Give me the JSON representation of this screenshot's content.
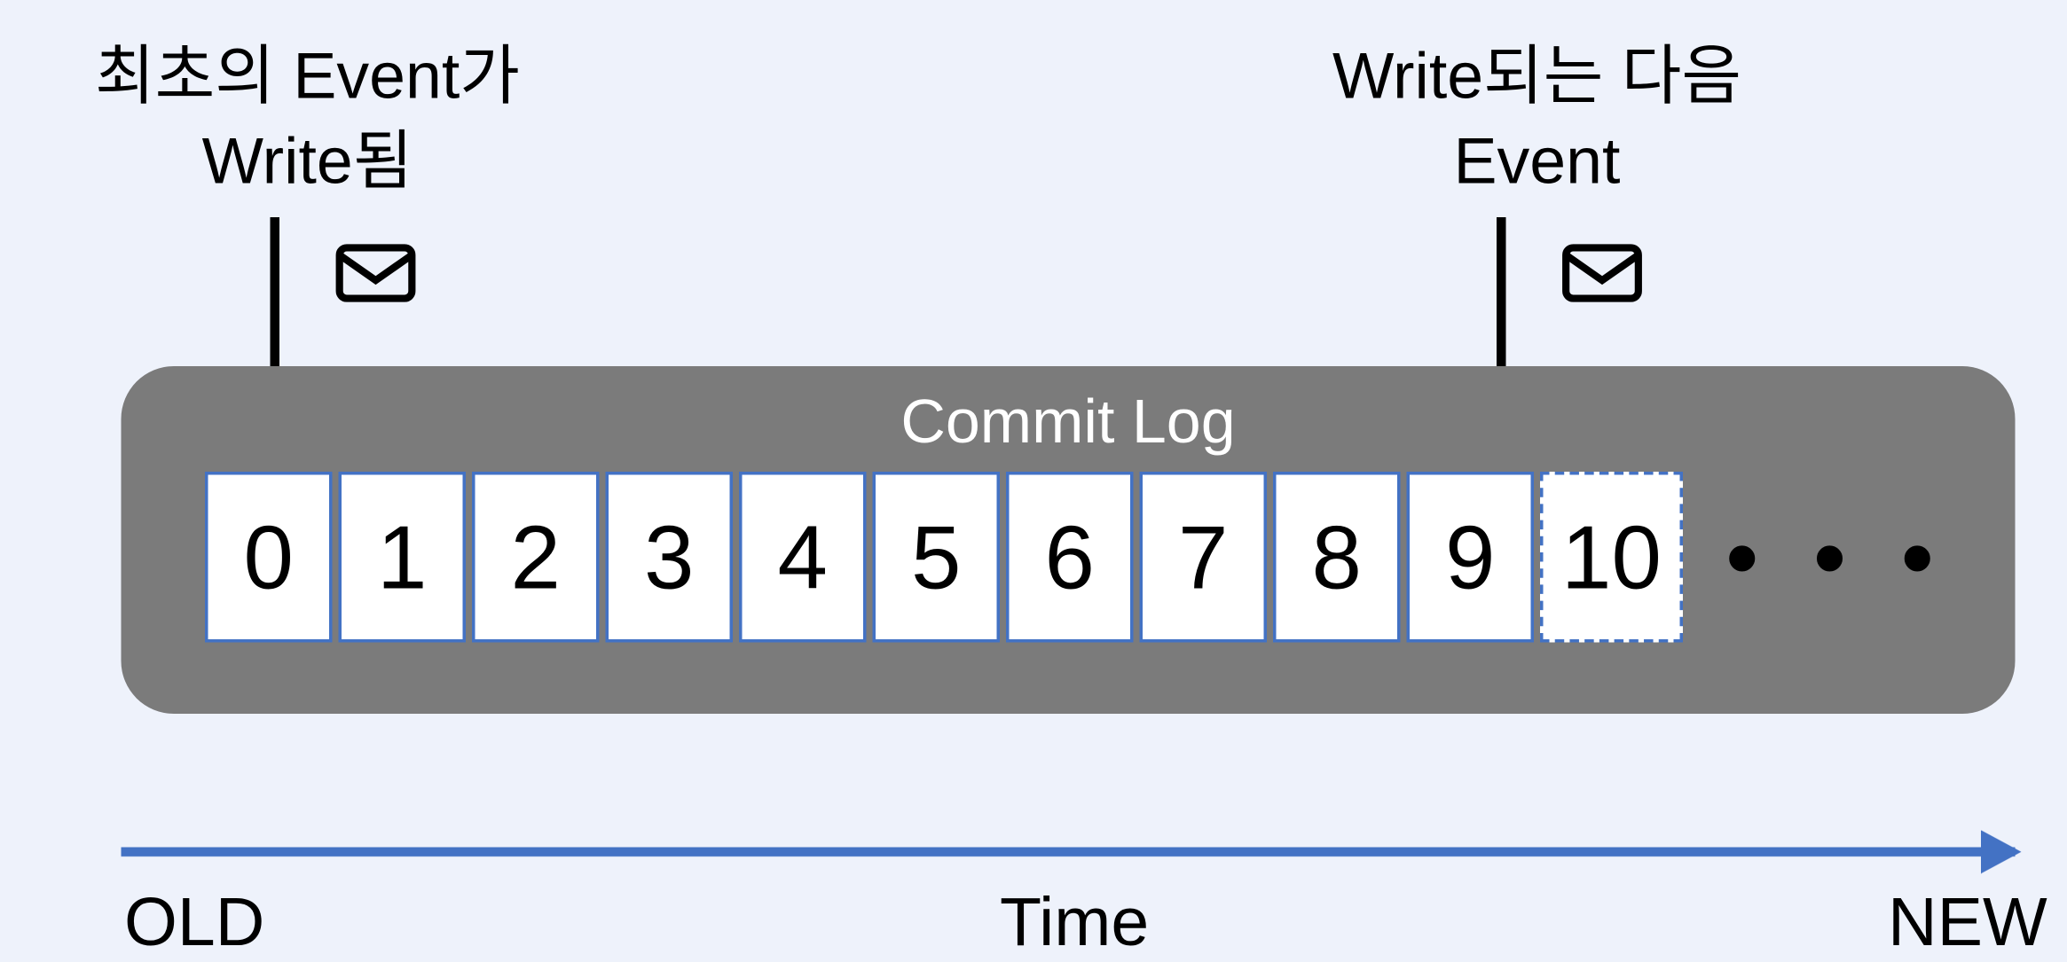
{
  "labels": {
    "first_event": "최초의 Event가\nWrite됨",
    "next_event": "Write되는 다음\nEvent"
  },
  "commit_log": {
    "title": "Commit Log",
    "cells": [
      "0",
      "1",
      "2",
      "3",
      "4",
      "5",
      "6",
      "7",
      "8",
      "9"
    ],
    "pending_cell": "10",
    "ellipsis": "• • •"
  },
  "timeline": {
    "old": "OLD",
    "center": "Time",
    "new": "NEW"
  },
  "icons": {
    "envelope": "envelope-icon"
  }
}
